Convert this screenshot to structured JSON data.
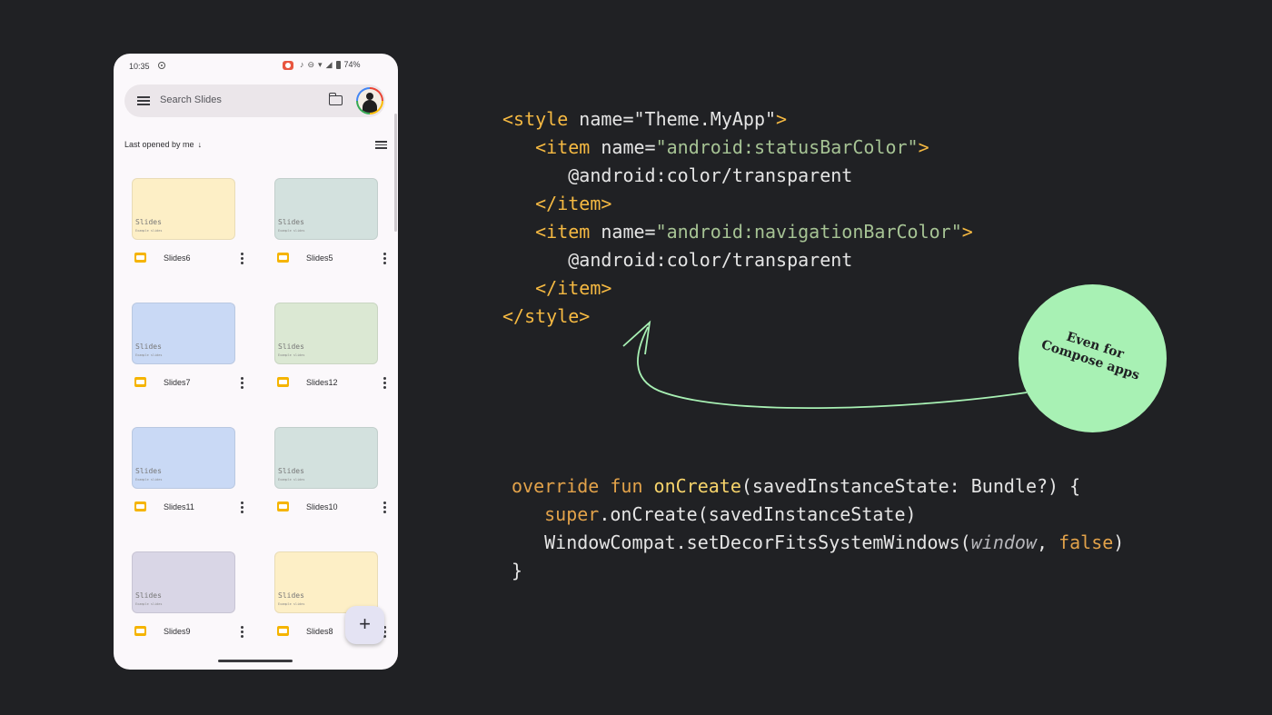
{
  "phone": {
    "status": {
      "time": "10:35",
      "battery": "74%"
    },
    "search": {
      "placeholder": "Search Slides"
    },
    "sort_label": "Last opened by me",
    "sort_arrow": "↓",
    "cards": [
      {
        "name": "Slides6",
        "thumb_title": "Slides",
        "thumb_sub": "Example slides",
        "color": "#fdefc6"
      },
      {
        "name": "Slides5",
        "thumb_title": "Slides",
        "thumb_sub": "Example slides",
        "color": "#d3e1de"
      },
      {
        "name": "Slides7",
        "thumb_title": "Slides",
        "thumb_sub": "Example slides",
        "color": "#c9d9f5"
      },
      {
        "name": "Slides12",
        "thumb_title": "Slides",
        "thumb_sub": "Example slides",
        "color": "#dbe8d3"
      },
      {
        "name": "Slides11",
        "thumb_title": "Slides",
        "thumb_sub": "Example slides",
        "color": "#c9d9f5"
      },
      {
        "name": "Slides10",
        "thumb_title": "Slides",
        "thumb_sub": "Example slides",
        "color": "#d3e1de"
      },
      {
        "name": "Slides9",
        "thumb_title": "Slides",
        "thumb_sub": "Example slides",
        "color": "#d9d6e6"
      },
      {
        "name": "Slides8",
        "thumb_title": "Slides",
        "thumb_sub": "Example slides",
        "color": "#fdefc6"
      }
    ],
    "fab_label": "+"
  },
  "xml_code": {
    "l1_open": "<style ",
    "l1_attr": "name=\"Theme.MyApp\"",
    "l1_close": ">",
    "l2_open": "<item ",
    "l2_attr": "name=",
    "l2_value": "\"android:statusBarColor\"",
    "l2_close": ">",
    "l3": "@android:color/transparent",
    "l4": "</item>",
    "l5_open": "<item ",
    "l5_attr": "name=",
    "l5_value": "\"android:navigationBarColor\"",
    "l5_close": ">",
    "l6": "@android:color/transparent",
    "l7": "</item>",
    "l8": "</style>"
  },
  "kotlin_code": {
    "l1_kw": "override fun ",
    "l1_fn": "onCreate",
    "l1_rest": "(savedInstanceState: Bundle?) {",
    "l2_kw": "super",
    "l2_rest": ".onCreate(savedInstanceState)",
    "l3_a": "WindowCompat.setDecorFitsSystemWindows(",
    "l3_b": "window",
    "l3_c": ", ",
    "l3_d": "false",
    "l3_e": ")",
    "l4": "}"
  },
  "bubble": {
    "line1": "Even for",
    "line2": "Compose apps",
    "color": "#a8f1b4"
  }
}
